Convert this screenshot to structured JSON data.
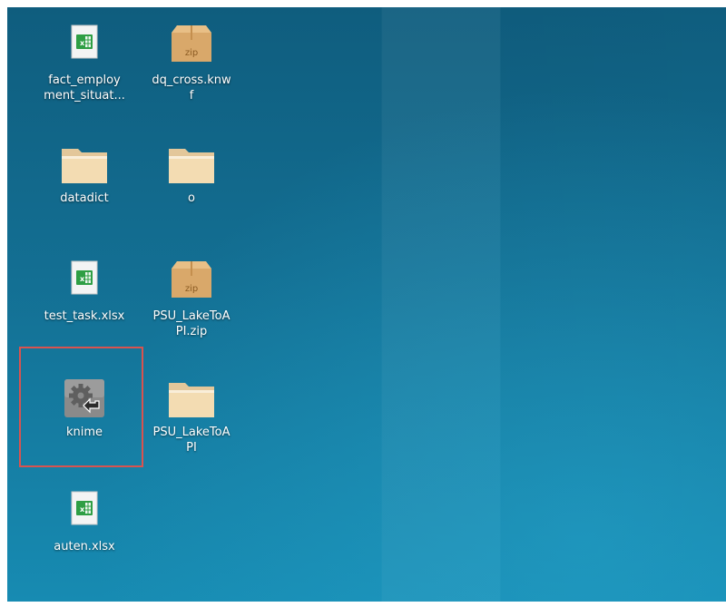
{
  "desktop": {
    "background_color": "#136f93",
    "icons": [
      {
        "label": "fact_employment_situat...",
        "label_line1": "fact_employ",
        "label_line2": "ment_situat...",
        "type": "spreadsheet-icon"
      },
      {
        "label": "dq_cross.knwf",
        "label_line1": "dq_cross.knw",
        "label_line2": "f",
        "type": "zip-archive-icon"
      },
      {
        "label": "datadict",
        "type": "folder-icon"
      },
      {
        "label": "o",
        "type": "folder-icon"
      },
      {
        "label": "test_task.xlsx",
        "type": "spreadsheet-icon"
      },
      {
        "label": "PSU_LakeToAPI.zip",
        "label_line1": "PSU_LakeToA",
        "label_line2": "PI.zip",
        "type": "zip-archive-icon"
      },
      {
        "label": "knime",
        "type": "executable-gear-icon",
        "highlighted": true
      },
      {
        "label": "PSU_LakeToAPI",
        "label_line1": "PSU_LakeToA",
        "label_line2": "PI",
        "type": "folder-icon"
      },
      {
        "label": "auten.xlsx",
        "type": "spreadsheet-icon"
      }
    ],
    "zip_badge_text": "zip",
    "highlight_color": "#d9534f"
  }
}
